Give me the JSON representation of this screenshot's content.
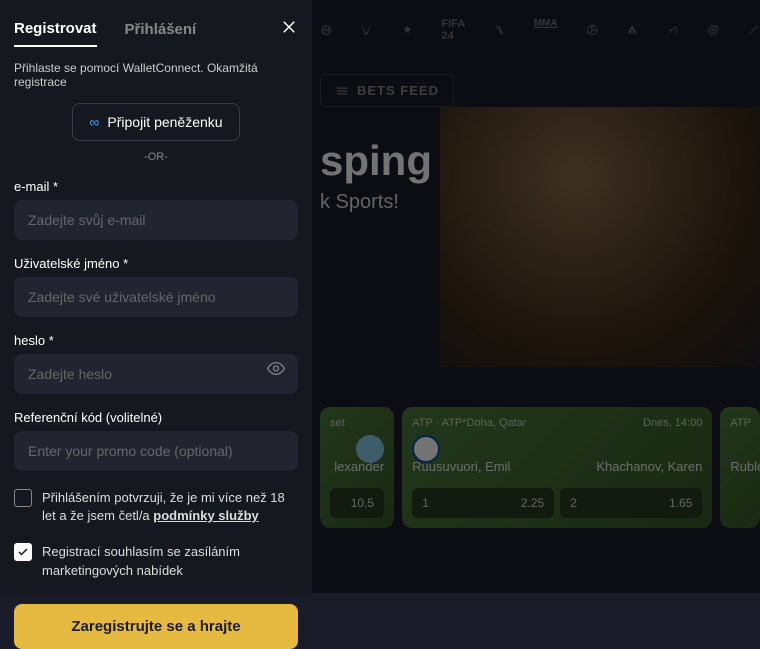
{
  "tabs": {
    "register": "Registrovat",
    "login": "Přihlášení"
  },
  "modal": {
    "wc_hint": "Přihlaste se pomocí WalletConnect. Okamžitá registrace",
    "wallet_btn": "Připojit peněženku",
    "or": "-OR-",
    "email_label": "e-mail *",
    "email_ph": "Zadejte svůj e-mail",
    "user_label": "Uživatelské jméno *",
    "user_ph": "Zadejte své uživatelské jméno",
    "pass_label": "heslo *",
    "pass_ph": "Zadejte heslo",
    "ref_label": "Referenční kód (volitelné)",
    "ref_ph": "Enter your promo code (optional)",
    "age_txt_a": "Přihlášením potvrzuji, že je mi více než 18 let a že jsem četl/a ",
    "age_terms": "podmínky služby",
    "mkt_txt": "Registrací souhlasím se zasíláním marketingových nabídek",
    "submit": "Zaregistrujte se a hrajte"
  },
  "bg": {
    "bets_feed": "BETS FEED",
    "hero_title": "sping",
    "hero_sub": "k Sports!"
  },
  "cards": [
    {
      "league_a": "ATP",
      "league_b": "ATP*Doha, Qatar",
      "time": "Dnes, 14:00",
      "player1": "Ruusuvuori, Emil",
      "player2": "Khachanov, Karen",
      "odds": [
        {
          "k": "1",
          "v": "2.25"
        },
        {
          "k": "2",
          "v": "1.65"
        }
      ]
    }
  ],
  "partial": {
    "player": "lexander",
    "odd": "10.5",
    "league": "set"
  },
  "partial2": {
    "league": "ATP",
    "player": "Ruble"
  }
}
